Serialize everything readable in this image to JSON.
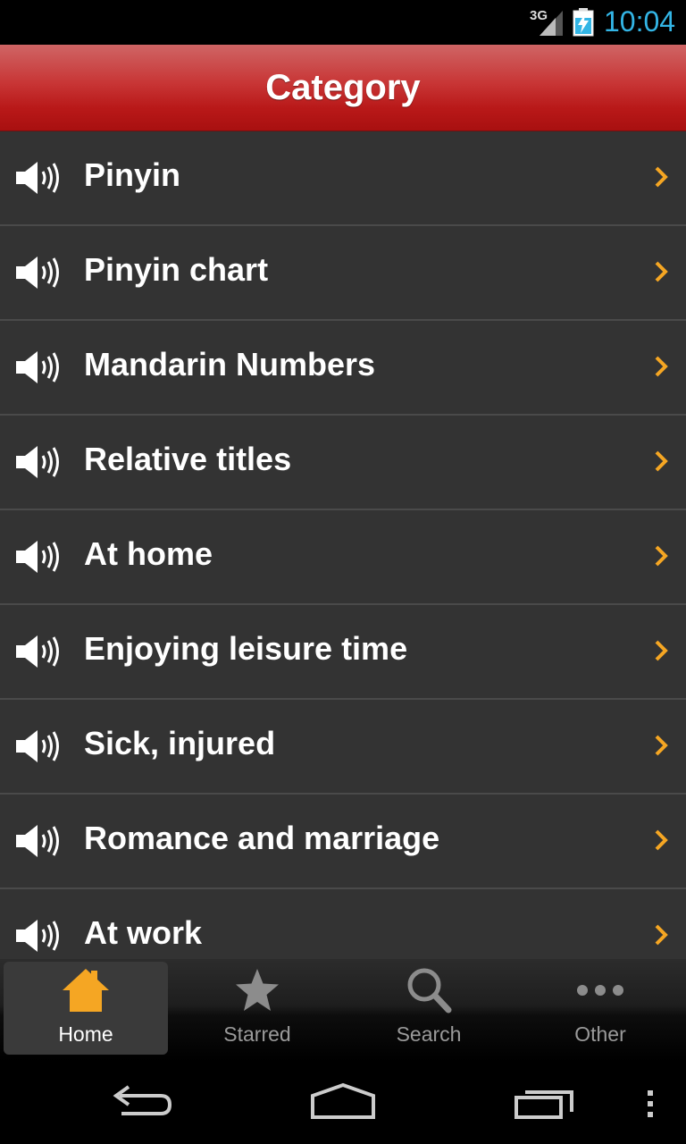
{
  "status_bar": {
    "network": "3G",
    "time": "10:04",
    "signal_icon": "signal-bars-icon",
    "battery_icon": "battery-charging-icon",
    "time_color": "#33b5e5"
  },
  "header": {
    "title": "Category",
    "color": "#c0272a"
  },
  "categories": [
    {
      "label": "Pinyin",
      "icon": "speaker-icon"
    },
    {
      "label": "Pinyin chart",
      "icon": "speaker-icon"
    },
    {
      "label": "Mandarin Numbers",
      "icon": "speaker-icon"
    },
    {
      "label": "Relative titles",
      "icon": "speaker-icon"
    },
    {
      "label": "At home",
      "icon": "speaker-icon"
    },
    {
      "label": "Enjoying leisure time",
      "icon": "speaker-icon"
    },
    {
      "label": "Sick, injured",
      "icon": "speaker-icon"
    },
    {
      "label": "Romance and marriage",
      "icon": "speaker-icon"
    },
    {
      "label": "At work",
      "icon": "speaker-icon"
    }
  ],
  "chevron_color": "#f5a623",
  "tabs": [
    {
      "label": "Home",
      "icon": "home-icon",
      "active": true
    },
    {
      "label": "Starred",
      "icon": "star-icon",
      "active": false
    },
    {
      "label": "Search",
      "icon": "search-icon",
      "active": false
    },
    {
      "label": "Other",
      "icon": "more-dots-icon",
      "active": false
    }
  ],
  "nav_bar": {
    "back_icon": "back-icon",
    "home_icon": "nav-home-icon",
    "recents_icon": "recent-apps-icon",
    "menu_icon": "overflow-menu-icon"
  }
}
